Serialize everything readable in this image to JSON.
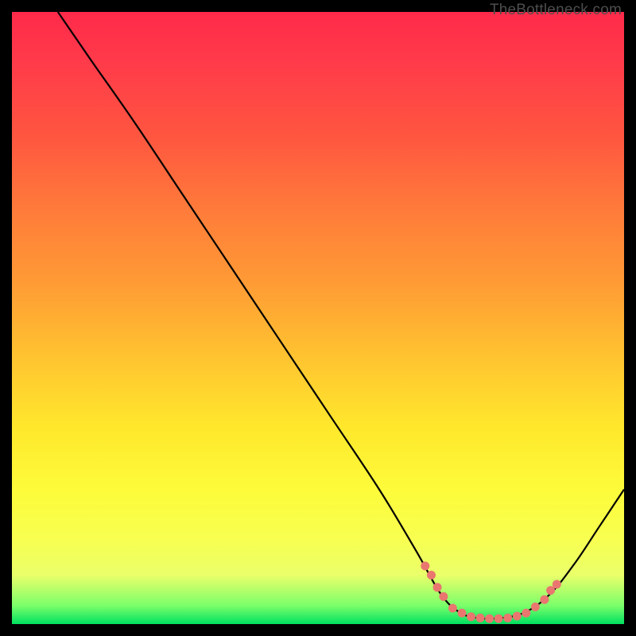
{
  "attribution": "TheBottleneck.com",
  "chart_data": {
    "type": "line",
    "title": "",
    "xlabel": "",
    "ylabel": "",
    "xlim": [
      0,
      100
    ],
    "ylim": [
      0,
      100
    ],
    "background": "rainbow-gradient-red-to-green",
    "main_curve": {
      "description": "Bottleneck curve descending from top-left, reaching a flat valley near x≈72-85 then rising",
      "points": [
        {
          "x": 7.5,
          "y": 100
        },
        {
          "x": 13.0,
          "y": 92
        },
        {
          "x": 20.0,
          "y": 82
        },
        {
          "x": 28.0,
          "y": 70
        },
        {
          "x": 36.0,
          "y": 58
        },
        {
          "x": 44.0,
          "y": 46
        },
        {
          "x": 52.0,
          "y": 34
        },
        {
          "x": 60.0,
          "y": 22
        },
        {
          "x": 66.0,
          "y": 12
        },
        {
          "x": 70.0,
          "y": 5
        },
        {
          "x": 73.0,
          "y": 2
        },
        {
          "x": 76.0,
          "y": 1
        },
        {
          "x": 80.0,
          "y": 1
        },
        {
          "x": 84.0,
          "y": 2
        },
        {
          "x": 88.0,
          "y": 5
        },
        {
          "x": 92.0,
          "y": 10
        },
        {
          "x": 96.0,
          "y": 16
        },
        {
          "x": 100.0,
          "y": 22
        }
      ]
    },
    "highlight_dots": {
      "description": "Salmon dots along the valley floor of the curve",
      "color": "#e9766f",
      "points": [
        {
          "x": 67.5,
          "y": 9.5
        },
        {
          "x": 68.5,
          "y": 8.0
        },
        {
          "x": 69.5,
          "y": 6.0
        },
        {
          "x": 70.5,
          "y": 4.5
        },
        {
          "x": 72.0,
          "y": 2.6
        },
        {
          "x": 73.5,
          "y": 1.8
        },
        {
          "x": 75.0,
          "y": 1.2
        },
        {
          "x": 76.5,
          "y": 1.0
        },
        {
          "x": 78.0,
          "y": 0.9
        },
        {
          "x": 79.5,
          "y": 0.9
        },
        {
          "x": 81.0,
          "y": 1.0
        },
        {
          "x": 82.5,
          "y": 1.3
        },
        {
          "x": 84.0,
          "y": 1.8
        },
        {
          "x": 85.5,
          "y": 2.8
        },
        {
          "x": 87.0,
          "y": 4.0
        },
        {
          "x": 88.0,
          "y": 5.5
        },
        {
          "x": 89.0,
          "y": 6.5
        }
      ]
    }
  }
}
